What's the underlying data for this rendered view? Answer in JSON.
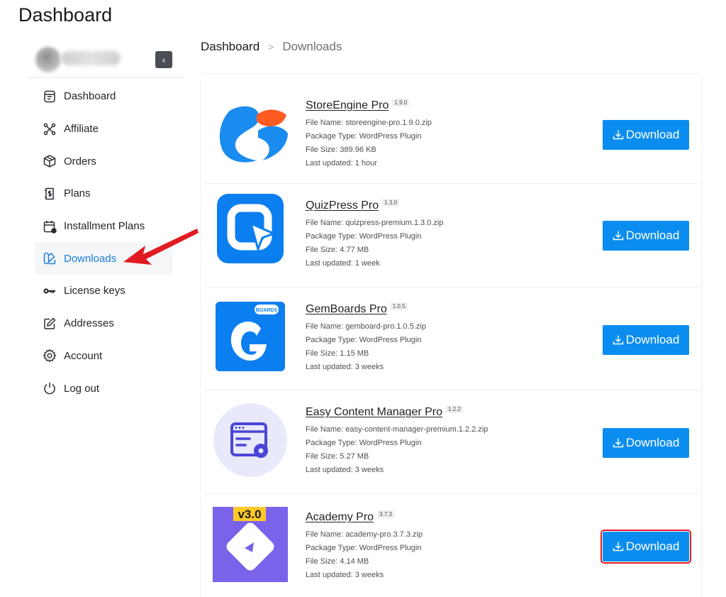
{
  "page": {
    "title": "Dashboard"
  },
  "sidebar": {
    "collapse_icon": "chevron-left-icon",
    "items": [
      {
        "label": "Dashboard",
        "icon": "dashboard-icon"
      },
      {
        "label": "Affiliate",
        "icon": "affiliate-icon"
      },
      {
        "label": "Orders",
        "icon": "box-icon"
      },
      {
        "label": "Plans",
        "icon": "plans-icon"
      },
      {
        "label": "Installment Plans",
        "icon": "calendar-icon"
      },
      {
        "label": "Downloads",
        "icon": "downloads-icon",
        "active": true
      },
      {
        "label": "License keys",
        "icon": "key-icon"
      },
      {
        "label": "Addresses",
        "icon": "edit-icon"
      },
      {
        "label": "Account",
        "icon": "gear-icon"
      },
      {
        "label": "Log out",
        "icon": "power-icon"
      }
    ]
  },
  "breadcrumb": {
    "home": "Dashboard",
    "separator": ">",
    "current": "Downloads"
  },
  "downloads": [
    {
      "name": "StoreEngine Pro",
      "version": "1.9.0",
      "file_name": "File Name: storeengine-pro.1.9.0.zip",
      "package_type": "Package Type: WordPress Plugin",
      "file_size": "File Size: 389.96 KB",
      "last_updated": "Last updated: 1 hour",
      "button": "Download",
      "logo": "storeengine-logo"
    },
    {
      "name": "QuizPress Pro",
      "version": "1.3.0",
      "file_name": "File Name: quizpress-premium.1.3.0.zip",
      "package_type": "Package Type: WordPress Plugin",
      "file_size": "File Size: 4.77 MB",
      "last_updated": "Last updated: 1 week",
      "button": "Download",
      "logo": "quizpress-logo"
    },
    {
      "name": "GemBoards Pro",
      "version": "1.0.5",
      "file_name": "File Name: gemboard-pro.1.0.5.zip",
      "package_type": "Package Type: WordPress Plugin",
      "file_size": "File Size: 1.15 MB",
      "last_updated": "Last updated: 3 weeks",
      "button": "Download",
      "logo": "gemboards-logo",
      "logo_badge": "BOARDS"
    },
    {
      "name": "Easy Content Manager Pro",
      "version": "1.2.2",
      "file_name": "File Name: easy-content-manager-premium.1.2.2.zip",
      "package_type": "Package Type: WordPress Plugin",
      "file_size": "File Size: 5.27 MB",
      "last_updated": "Last updated: 3 weeks",
      "button": "Download",
      "logo": "easy-content-manager-logo"
    },
    {
      "name": "Academy Pro",
      "version": "3.7.3",
      "file_name": "File Name: academy-pro.3.7.3.zip",
      "package_type": "Package Type: WordPress Plugin",
      "file_size": "File Size: 4.14 MB",
      "last_updated": "Last updated: 3 weeks",
      "button": "Download",
      "logo": "academy-logo",
      "logo_badge": "v3.0",
      "highlighted": true
    }
  ],
  "colors": {
    "accent": "#0b8df0",
    "active_nav": "#1a7fe0",
    "annotation": "#e11b22"
  }
}
